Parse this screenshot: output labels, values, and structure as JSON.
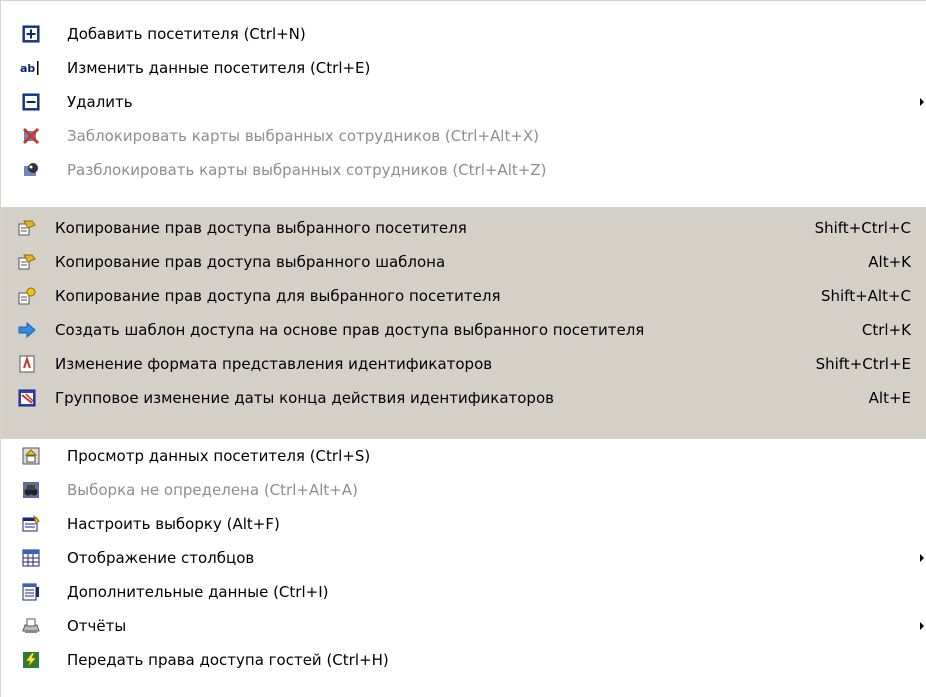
{
  "menu": {
    "top_items": [
      {
        "label": "Добавить посетителя (Ctrl+N)",
        "icon": "add-icon",
        "enabled": true
      },
      {
        "label": "Изменить данные посетителя (Ctrl+E)",
        "icon": "edit-text-icon",
        "enabled": true
      },
      {
        "label": "Удалить",
        "icon": "remove-icon",
        "enabled": true,
        "submenu": true
      },
      {
        "label": "Заблокировать карты выбранных сотрудников (Ctrl+Alt+X)",
        "icon": "block-cards-icon",
        "enabled": false
      },
      {
        "label": "Разблокировать карты выбранных сотрудников (Ctrl+Alt+Z)",
        "icon": "unblock-cards-icon",
        "enabled": false
      }
    ],
    "group_items": [
      {
        "label": "Копирование прав доступа выбранного посетителя",
        "shortcut": "Shift+Ctrl+C",
        "icon": "copy-rights-icon"
      },
      {
        "label": "Копирование прав доступа выбранного шаблона",
        "shortcut": "Alt+K",
        "icon": "copy-template-icon"
      },
      {
        "label": "Копирование прав доступа для выбранного посетителя",
        "shortcut": "Shift+Alt+C",
        "icon": "copy-to-visitor-icon"
      },
      {
        "label": "Создать шаблон доступа на основе прав доступа выбранного посетителя",
        "shortcut": "Ctrl+K",
        "icon": "arrow-right-icon"
      },
      {
        "label": "Изменение формата представления идентификаторов",
        "shortcut": "Shift+Ctrl+E",
        "icon": "format-document-icon"
      },
      {
        "label": "Групповое изменение даты конца действия идентификаторов",
        "shortcut": "Alt+E",
        "icon": "calendar-icon"
      }
    ],
    "bottom_items": [
      {
        "label": "Просмотр данных посетителя (Ctrl+S)",
        "icon": "view-details-icon",
        "enabled": true
      },
      {
        "label": "Выборка не определена (Ctrl+Alt+A)",
        "icon": "binoculars-icon",
        "enabled": false
      },
      {
        "label": "Настроить выборку (Alt+F)",
        "icon": "configure-filter-icon",
        "enabled": true
      },
      {
        "label": "Отображение столбцов",
        "icon": "columns-icon",
        "enabled": true,
        "submenu": true
      },
      {
        "label": "Дополнительные данные (Ctrl+I)",
        "icon": "extra-data-icon",
        "enabled": true
      },
      {
        "label": "Отчёты",
        "icon": "printer-icon",
        "enabled": true,
        "submenu": true
      },
      {
        "label": "Передать права доступа гостей (Ctrl+H)",
        "icon": "lightning-icon",
        "enabled": true
      }
    ]
  },
  "colors": {
    "menu_bg": "#ffffff",
    "group_bg": "#d4d0c8",
    "disabled_text": "#8e8e8e",
    "icon_blue": "#0a246a",
    "icon_accent": "#2f6fd6"
  }
}
